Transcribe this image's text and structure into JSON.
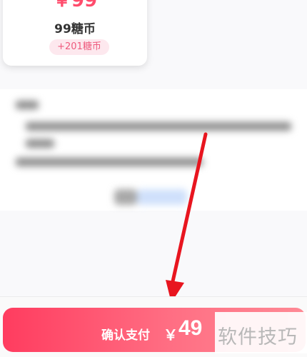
{
  "package": {
    "price": "￥99",
    "amount": "99糖币",
    "bonus": "+201糖币"
  },
  "payment": {
    "confirm_label": "确认支付",
    "currency": "￥",
    "amount": "49"
  },
  "watermark": "软件技巧",
  "colors": {
    "accent": "#ff3c5f",
    "bonus_bg": "#fde8ee",
    "arrow": "#e8151f"
  }
}
